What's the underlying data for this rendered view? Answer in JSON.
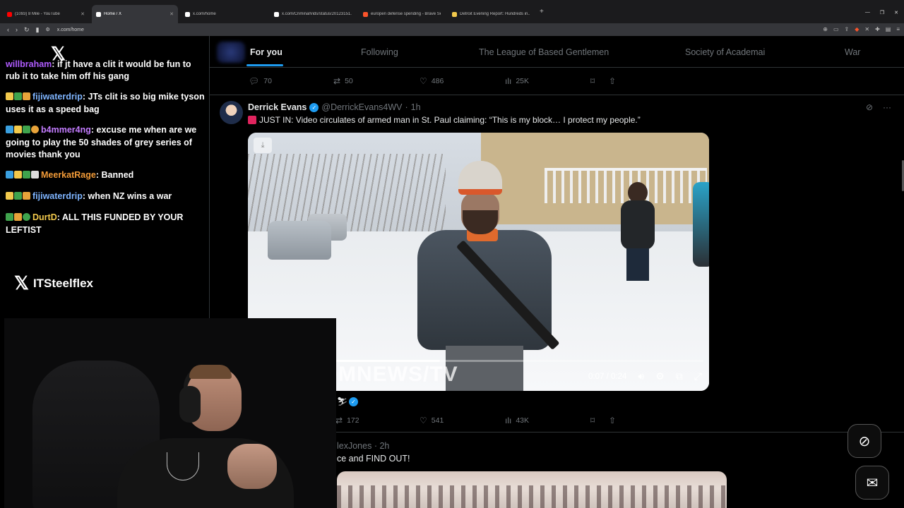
{
  "browser": {
    "tabs": [
      {
        "title": "(1093) 8 Mile - YouTube",
        "color": "#ff0000",
        "active": false
      },
      {
        "title": "Home / X",
        "color": "#ffffff",
        "active": true
      },
      {
        "title": "x.com/home",
        "color": "#ffffff",
        "active": false
      },
      {
        "title": "x.com/CriminalVids/status/20123151...",
        "color": "#ffffff",
        "active": false
      },
      {
        "title": "europen defense spending - Brave Se...",
        "color": "#fb542b",
        "active": false
      },
      {
        "title": "Detroit Evening Report: Hundreds in...",
        "color": "#f2c94c",
        "active": false
      }
    ],
    "url": "x.com/home"
  },
  "chat": {
    "messages": [
      {
        "user": "willbraham",
        "user_color": "#b05cff",
        "text": "if jt have a clit it would be fun to rub it to take him off his gang"
      },
      {
        "user": "fijiwaterdrip",
        "user_color": "#7fb5ff",
        "text": "JTs clit is so big mike tyson uses it as a speed bag"
      },
      {
        "user": "b4mmer4ng",
        "user_color": "#c37cff",
        "text": "excuse me when are we going to play the 50 shades of grey series of movies thank you"
      },
      {
        "user": "MeerkatRage",
        "user_color": "#f29b38",
        "text": "Banned"
      },
      {
        "user": "fijiwaterdrip",
        "user_color": "#7fb5ff",
        "text": "when NZ wins a war"
      },
      {
        "user": "DurtD",
        "user_color": "#f2c94c",
        "text": "ALL THIS FUNDED BY YOUR LEFTIST"
      }
    ],
    "brand_handle": "ITSteelflex"
  },
  "feed": {
    "tabs": [
      "For you",
      "Following",
      "The League of Based Gentlemen",
      "Society of Academai",
      "War"
    ],
    "prev_post_stats": {
      "replies": "70",
      "reposts": "50",
      "likes": "486",
      "views": "25K"
    },
    "post": {
      "author": "Derrick Evans",
      "handle": "@DerrickEvans4WV",
      "time": "1h",
      "text": "JUST IN: Video circulates of armed man in St. Paul claiming: “This is my block… I protect my people.”",
      "video": {
        "watermark": "EDOMNEWS/TV",
        "time": "0:07 / 0:24",
        "progress": 0.29
      },
      "stats": {
        "reposts": "172",
        "likes": "541",
        "views": "43K"
      }
    },
    "post3": {
      "handle_partial": "lexJones",
      "time": "2h",
      "text_partial": "ce and FIND OUT!"
    }
  }
}
